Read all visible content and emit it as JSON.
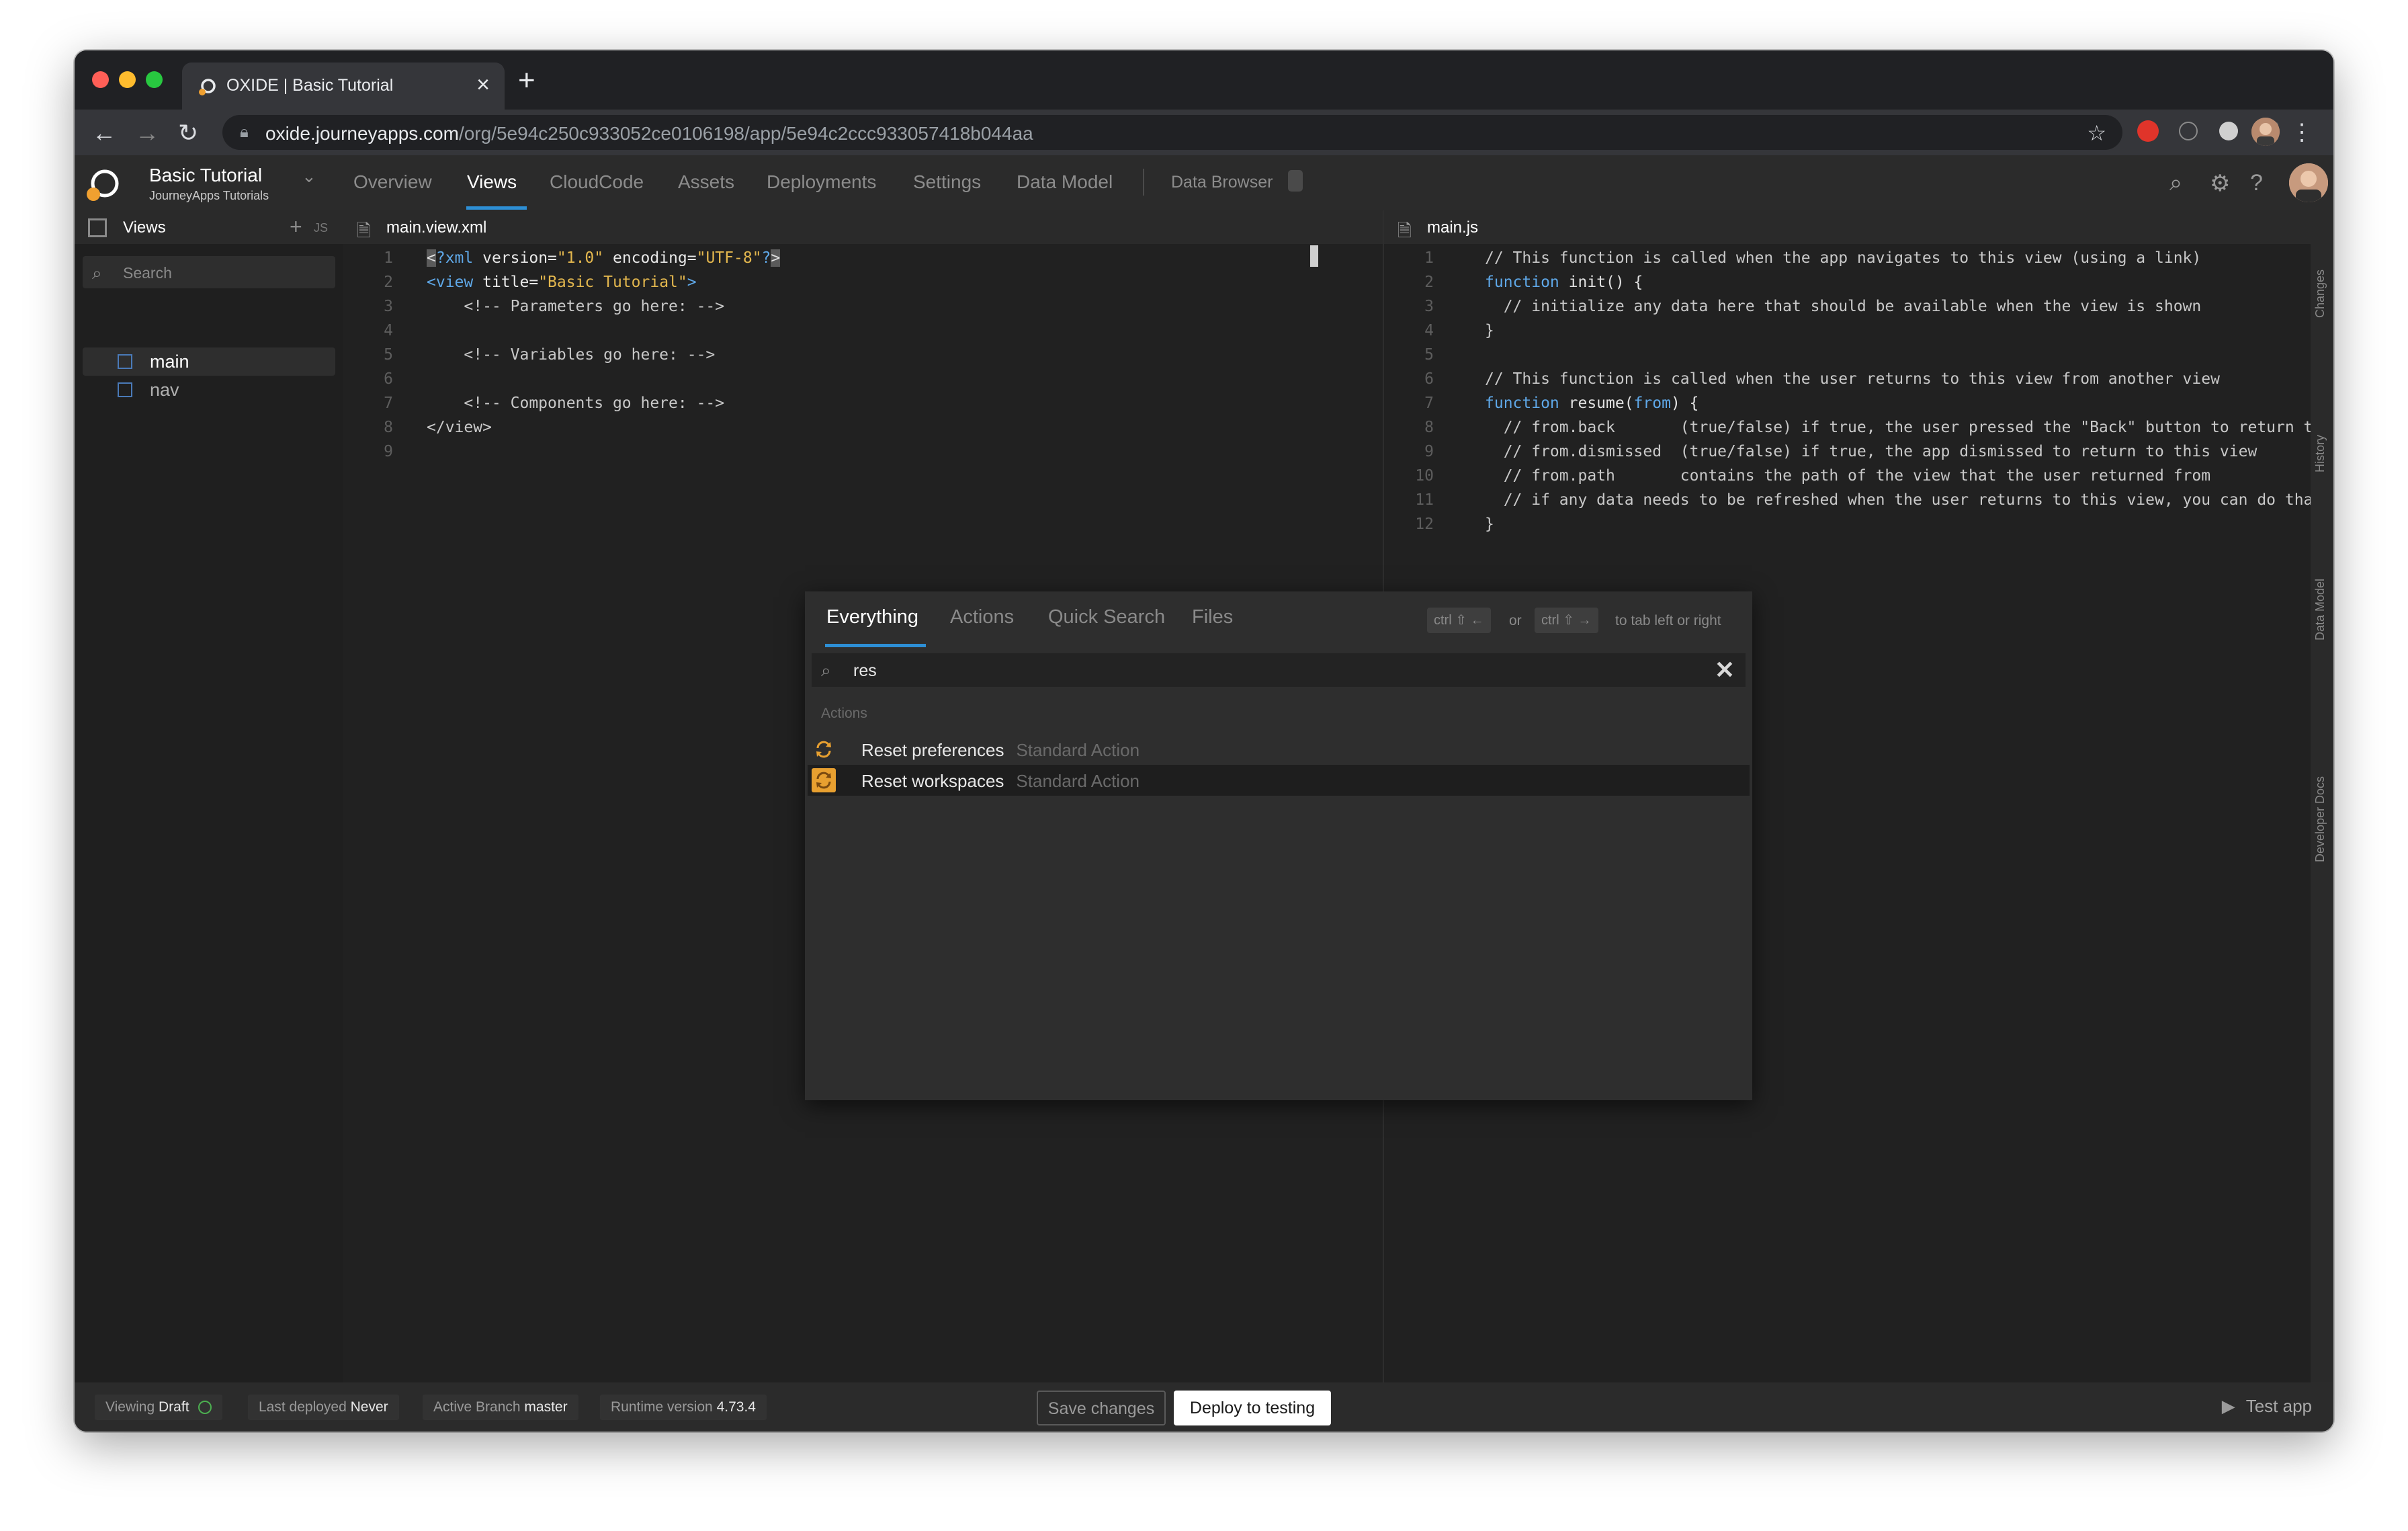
{
  "browser": {
    "tab_title": "OXIDE | Basic Tutorial",
    "tab_close": "×",
    "new_tab": "+",
    "url_host": "oxide.journeyapps.com",
    "url_path": "/org/5e94c250c933052ce0106198/app/5e94c2ccc933057418b044aa"
  },
  "app": {
    "project_title": "Basic Tutorial",
    "project_subtitle": "JourneyApps Tutorials",
    "nav_tabs": [
      "Overview",
      "Views",
      "CloudCode",
      "Assets",
      "Deployments",
      "Settings",
      "Data Model",
      "Data Browser"
    ],
    "active_tab": "Views"
  },
  "sidebar": {
    "title": "Views",
    "add_label": "+",
    "js_label": "JS",
    "search_placeholder": "Search",
    "items": [
      {
        "label": "main",
        "selected": true
      },
      {
        "label": "nav",
        "selected": false
      }
    ]
  },
  "left_editor": {
    "filename": "main.view.xml",
    "line_numbers": [
      "1",
      "2",
      "3",
      "4",
      "5",
      "6",
      "7",
      "8",
      "9"
    ],
    "lines": [
      "<?xml version=\"1.0\" encoding=\"UTF-8\"?>",
      "<view title=\"Basic Tutorial\">",
      "    <!-- Parameters go here: -->",
      "",
      "    <!-- Variables go here: -->",
      "",
      "    <!-- Components go here: -->",
      "</view>",
      ""
    ]
  },
  "right_editor": {
    "filename": "main.js",
    "line_numbers": [
      "1",
      "2",
      "3",
      "4",
      "5",
      "6",
      "7",
      "8",
      "9",
      "10",
      "11",
      "12"
    ],
    "lines": [
      "// This function is called when the app navigates to this view (using a link)",
      "function init() {",
      "  // initialize any data here that should be available when the view is shown",
      "}",
      "",
      "// This function is called when the user returns to this view from another view",
      "function resume(from) {",
      "  // from.back       (true/false) if true, the user pressed the \"Back\" button to return to th",
      "  // from.dismissed  (true/false) if true, the app dismissed to return to this view",
      "  // from.path       contains the path of the view that the user returned from",
      "  // if any data needs to be refreshed when the user returns to this view, you can do that he",
      "}"
    ]
  },
  "side_panels": [
    "Changes",
    "History",
    "Data Model",
    "Developer Docs"
  ],
  "palette": {
    "tabs": [
      "Everything",
      "Actions",
      "Quick Search",
      "Files"
    ],
    "active_tab": "Everything",
    "hint_key_left": "ctrl ⇧ ←",
    "hint_or": "or",
    "hint_key_right": "ctrl ⇧ →",
    "hint_text": "to tab left or right",
    "search_value": "res",
    "section_label": "Actions",
    "results": [
      {
        "label": "Reset preferences",
        "kind": "Standard Action",
        "selected": false
      },
      {
        "label": "Reset workspaces",
        "kind": "Standard Action",
        "selected": true
      }
    ],
    "accent_color": "#e8a030"
  },
  "status": {
    "viewing_label": "Viewing",
    "viewing_value": "Draft",
    "last_deployed_label": "Last deployed",
    "last_deployed_value": "Never",
    "branch_label": "Active Branch",
    "branch_value": "master",
    "runtime_label": "Runtime version",
    "runtime_value": "4.73.4",
    "save_button": "Save changes",
    "deploy_button": "Deploy to testing",
    "test_app": "Test app"
  },
  "colors": {
    "accent_blue": "#2d8fd5",
    "action_orange": "#e8a030",
    "comment_green": "#6aa040",
    "string_yellow": "#e3b74e",
    "tag_blue": "#5fa8e8"
  }
}
